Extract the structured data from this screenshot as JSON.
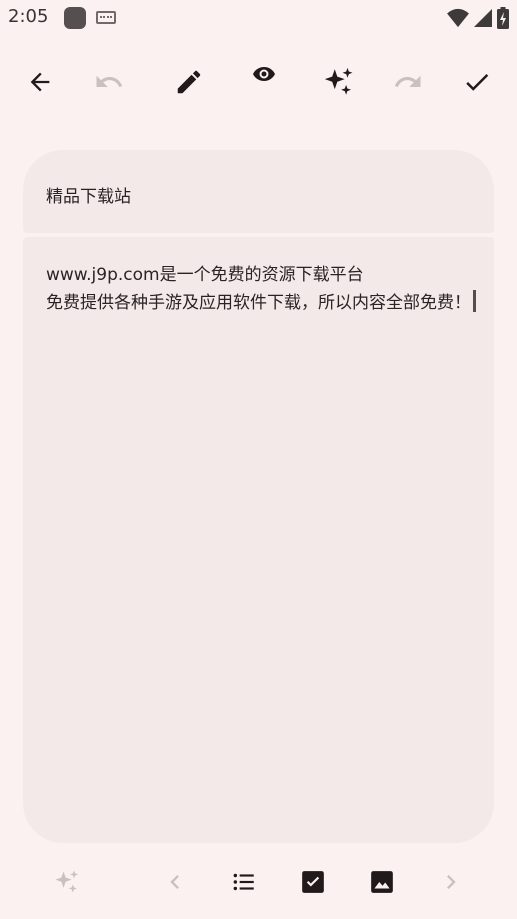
{
  "status_bar": {
    "time": "2:05",
    "icons": [
      "app-square-icon",
      "keyboard-icon",
      "wifi-icon",
      "signal-icon",
      "battery-icon"
    ]
  },
  "toolbar": {
    "buttons": [
      {
        "name": "back",
        "icon": "arrow-left-icon",
        "enabled": true
      },
      {
        "name": "undo",
        "icon": "undo-icon",
        "enabled": false
      },
      {
        "name": "edit",
        "icon": "pencil-icon",
        "enabled": true
      },
      {
        "name": "preview",
        "icon": "eye-icon",
        "enabled": true
      },
      {
        "name": "ai-assist",
        "icon": "sparkle-icon",
        "enabled": true
      },
      {
        "name": "redo",
        "icon": "redo-icon",
        "enabled": false
      },
      {
        "name": "done",
        "icon": "check-icon",
        "enabled": true
      }
    ]
  },
  "note": {
    "title": "精品下载站",
    "body": "www.j9p.com是一个免费的资源下载平台\n免费提供各种手游及应用软件下载，所以内容全部免费！"
  },
  "bottom_bar": {
    "buttons": [
      {
        "name": "ai",
        "icon": "sparkle-icon",
        "enabled": false
      },
      {
        "name": "prev",
        "icon": "chevron-left-icon",
        "enabled": false
      },
      {
        "name": "bullet-list",
        "icon": "list-icon",
        "enabled": true
      },
      {
        "name": "checkbox",
        "icon": "checkbox-icon",
        "enabled": true
      },
      {
        "name": "image",
        "icon": "image-icon",
        "enabled": true
      },
      {
        "name": "next",
        "icon": "chevron-right-icon",
        "enabled": false
      }
    ]
  },
  "colors": {
    "background": "#fbf1f0",
    "card": "#f3e9e9",
    "icon_active": "#201a1a",
    "icon_disabled": "#cbbfc0"
  }
}
